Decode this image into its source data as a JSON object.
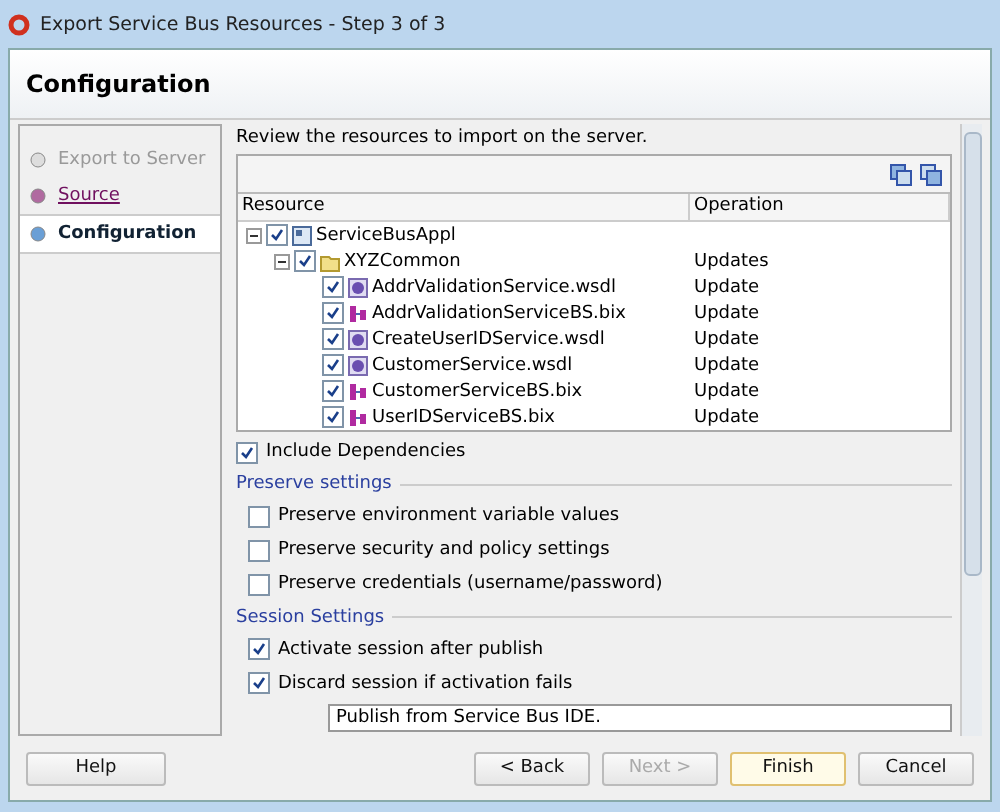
{
  "window": {
    "title": "Export Service Bus Resources - Step 3 of 3"
  },
  "header": {
    "title": "Configuration"
  },
  "steps": [
    {
      "label": "Export to Server",
      "kind": "disabled",
      "selected": false
    },
    {
      "label": "Source",
      "kind": "link",
      "selected": false
    },
    {
      "label": "Configuration",
      "kind": "current",
      "selected": true
    }
  ],
  "intro": "Review the resources to import on the server.",
  "table": {
    "columns": [
      "Resource",
      "Operation"
    ],
    "rows": [
      {
        "name": "ServiceBusAppl",
        "kind": "project",
        "checked": true,
        "expanded": true,
        "operation": "",
        "children": [
          {
            "name": "XYZCommon",
            "kind": "folder",
            "checked": true,
            "expanded": true,
            "operation": "Updates",
            "children": [
              {
                "name": "AddrValidationService.wsdl",
                "kind": "wsdl",
                "checked": true,
                "operation": "Update"
              },
              {
                "name": "AddrValidationServiceBS.bix",
                "kind": "bix",
                "checked": true,
                "operation": "Update"
              },
              {
                "name": "CreateUserIDService.wsdl",
                "kind": "wsdl",
                "checked": true,
                "operation": "Update"
              },
              {
                "name": "CustomerService.wsdl",
                "kind": "wsdl",
                "checked": true,
                "operation": "Update"
              },
              {
                "name": "CustomerServiceBS.bix",
                "kind": "bix",
                "checked": true,
                "operation": "Update"
              },
              {
                "name": "UserIDServiceBS.bix",
                "kind": "bix",
                "checked": true,
                "operation": "Update"
              }
            ]
          }
        ]
      }
    ]
  },
  "include_dependencies": {
    "label": "Include Dependencies",
    "checked": true
  },
  "sections": [
    {
      "title": "Preserve settings",
      "options": [
        {
          "label": "Preserve environment variable values",
          "checked": false
        },
        {
          "label": "Preserve security and policy settings",
          "checked": false
        },
        {
          "label": "Preserve credentials (username/password)",
          "checked": false
        }
      ]
    },
    {
      "title": "Session Settings",
      "options": [
        {
          "label": "Activate session after publish",
          "checked": true
        },
        {
          "label": "Discard session if activation fails",
          "checked": true
        }
      ]
    }
  ],
  "session_description": {
    "value": "Publish from Service Bus IDE."
  },
  "buttons": [
    {
      "label": "Help",
      "kind": "plain",
      "disabled": false
    },
    {
      "label": "< Back",
      "kind": "plain",
      "disabled": false
    },
    {
      "label": "Next >",
      "kind": "plain",
      "disabled": true
    },
    {
      "label": "Finish",
      "kind": "default",
      "disabled": false
    },
    {
      "label": "Cancel",
      "kind": "plain",
      "disabled": false
    }
  ]
}
